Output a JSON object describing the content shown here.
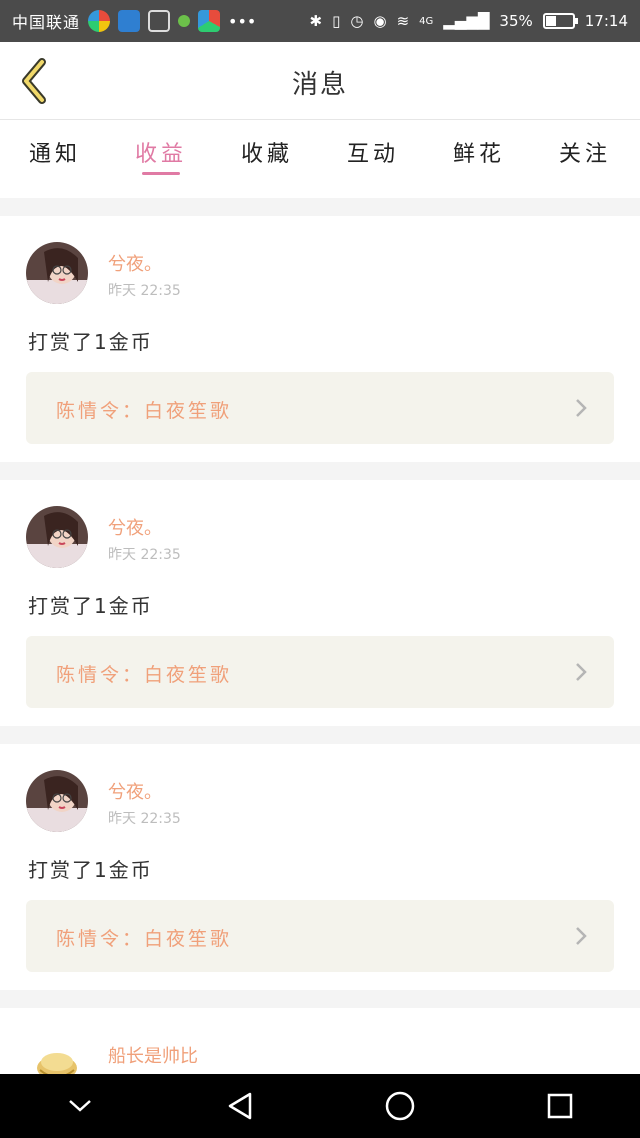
{
  "status_bar": {
    "carrier": "中国联通",
    "battery_text": "35%",
    "battery_level": 0.35,
    "time": "17:14",
    "network": "4G"
  },
  "header": {
    "title": "消息",
    "back_icon": "back-chevron-icon"
  },
  "tabs": [
    {
      "label": "通知",
      "active": false
    },
    {
      "label": "收益",
      "active": true
    },
    {
      "label": "收藏",
      "active": false
    },
    {
      "label": "互动",
      "active": false
    },
    {
      "label": "鲜花",
      "active": false
    },
    {
      "label": "关注",
      "active": false
    }
  ],
  "items": [
    {
      "name": "兮夜。",
      "time": "昨天 22:35",
      "message": "打赏了1金币",
      "source": "陈情令：白夜笙歌"
    },
    {
      "name": "兮夜。",
      "time": "昨天 22:35",
      "message": "打赏了1金币",
      "source": "陈情令：白夜笙歌"
    },
    {
      "name": "兮夜。",
      "time": "昨天 22:35",
      "message": "打赏了1金币",
      "source": "陈情令：白夜笙歌"
    },
    {
      "name": "船长是帅比"
    }
  ],
  "colors": {
    "accent": "#e07aa4",
    "name": "#f0a07a",
    "source_bg": "#f4f3ec"
  }
}
